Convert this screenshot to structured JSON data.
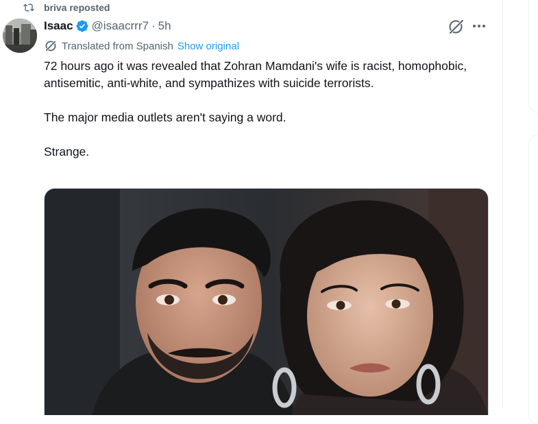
{
  "repost": {
    "label": "briva reposted"
  },
  "tweet": {
    "author_name": "Isaac",
    "author_handle": "@isaacrrr7",
    "separator": "·",
    "time": "5h",
    "translation_label": "Translated from Spanish",
    "show_original_label": "Show original",
    "text": [
      "72 hours ago it was revealed that Zohran Mamdani's wife is racist, homophobic, antisemitic, anti-white, and sympathizes with suicide terrorists.",
      "The major media outlets aren't saying a word.",
      "Strange."
    ]
  },
  "icons": {
    "repost": "repost-icon",
    "verified": "verified-badge-icon",
    "grok": "grok-icon",
    "more": "more-icon",
    "translate": "translate-icon"
  },
  "colors": {
    "accent": "#1d9bf0",
    "secondary_text": "#536471",
    "primary_text": "#0f1419"
  }
}
